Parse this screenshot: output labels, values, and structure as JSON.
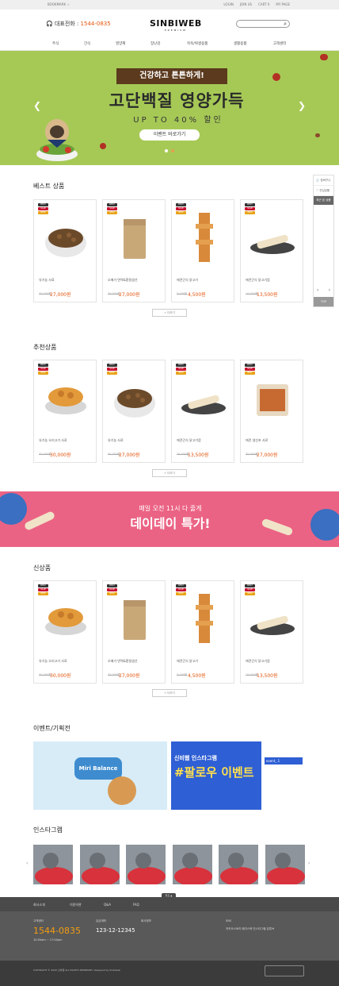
{
  "topbar": {
    "bookmark": "BOOKMARK ☆",
    "links": [
      "LOGIN",
      "JOIN US",
      "CART 0",
      "MY PAGE"
    ]
  },
  "header": {
    "phone_label": "대표전화 :",
    "phone": "1544-0835",
    "logo": "SINBIWEB",
    "logo_sub": "PREMIUM"
  },
  "nav": [
    "주식",
    "간식",
    "영양제",
    "장난감",
    "목욕/위생용품",
    "생활용품",
    "고객센터"
  ],
  "hero": {
    "tag": "건강하고 튼튼하게!",
    "headline": "고단백질 영양가득",
    "sub": "UP TO 40% 할인",
    "cta": "이벤트 바로가기"
  },
  "side": {
    "cart": "장바구니",
    "wish": "관심상품",
    "recent": "최근 본 상품",
    "top": "TOP"
  },
  "sections": {
    "best": {
      "title": "베스트 상품",
      "more": "+ 더보기",
      "items": [
        {
          "name": "유기농 사료",
          "old": "35,000원",
          "price": "27,000원",
          "badges": [
            "BEST",
            "SALE",
            "NEW"
          ]
        },
        {
          "name": "오메가 면역&환절생선",
          "old": "35,000원",
          "price": "27,000원",
          "badges": [
            "BEST",
            "SALE",
            "NEW"
          ]
        },
        {
          "name": "애견간식 닭고기",
          "old": "5,000원",
          "price": "4,500원",
          "badges": [
            "BEST",
            "SALE",
            "NEW"
          ]
        },
        {
          "name": "애견간식 닭고기껌",
          "old": "15,000원",
          "price": "13,500원",
          "badges": [
            "BEST",
            "SALE",
            "NEW"
          ]
        }
      ]
    },
    "recommend": {
      "title": "추천상품",
      "more": "+ 더보기",
      "items": [
        {
          "name": "유기농 오리고기 사료",
          "old": "35,000원",
          "price": "30,000원",
          "badges": [
            "BEST",
            "SALE",
            "NEW"
          ]
        },
        {
          "name": "유기농 사료",
          "old": "35,000원",
          "price": "27,000원",
          "badges": [
            "BEST",
            "SALE",
            "NEW"
          ]
        },
        {
          "name": "애견간식 닭고기껌",
          "old": "15,000원",
          "price": "13,500원",
          "badges": [
            "BEST",
            "SALE",
            "NEW"
          ]
        },
        {
          "name": "애견 생선포 사료",
          "old": "35,000원",
          "price": "27,000원",
          "badges": [
            "BEST",
            "SALE",
            "NEW"
          ]
        }
      ]
    },
    "new": {
      "title": "신상품",
      "more": "+ 더보기",
      "items": [
        {
          "name": "유기농 오리고기 사료",
          "old": "35,000원",
          "price": "30,000원",
          "badges": [
            "BEST",
            "SALE",
            "NEW"
          ]
        },
        {
          "name": "오메가 면역&환절생선",
          "old": "35,000원",
          "price": "27,000원",
          "badges": [
            "BEST",
            "SALE",
            "NEW"
          ]
        },
        {
          "name": "애견간식 닭고기",
          "old": "5,000원",
          "price": "4,500원",
          "badges": [
            "BEST",
            "SALE",
            "NEW"
          ]
        },
        {
          "name": "애견간식 닭고기껌",
          "old": "15,000원",
          "price": "13,500원",
          "badges": [
            "BEST",
            "SALE",
            "NEW"
          ]
        }
      ]
    }
  },
  "promo": {
    "line1": "매일 오전 11시 다 줄게",
    "line2": "데이데이 특가!"
  },
  "events": {
    "title": "이벤트/기획전",
    "left_title": "Miri Balance",
    "right_tag": "event_ 1",
    "right_title": "신비웹 인스타그램",
    "right_big": "#팔로우 이벤트"
  },
  "instagram": {
    "title": "인스타그램"
  },
  "footer": {
    "links": [
      "회사소개",
      "이용약관",
      "Q&A",
      "FAQ"
    ],
    "top_btn": "위로 ▲",
    "cs_label": "고객센터",
    "cs_phone": "1544-0835",
    "cs_hours": "10:00am ~ 17:00pm",
    "bank_label": "입금계좌",
    "bank_no": "123-12-12345",
    "company_label": "회사정보",
    "sns_label": "SNS",
    "sns_links": "카카오스토리 페이스북 인스타그램 유튜브",
    "copyright": "COPYRIGHT © 2020 신비웹 ALL RIGHTS RESERVED. Designed by Sinbiweb"
  },
  "colors": {
    "accent": "#e4540c",
    "hero_bg": "#a6c956",
    "promo_bg": "#eb6384",
    "best": "#333333",
    "sale": "#c8102e",
    "new": "#e8a317"
  }
}
